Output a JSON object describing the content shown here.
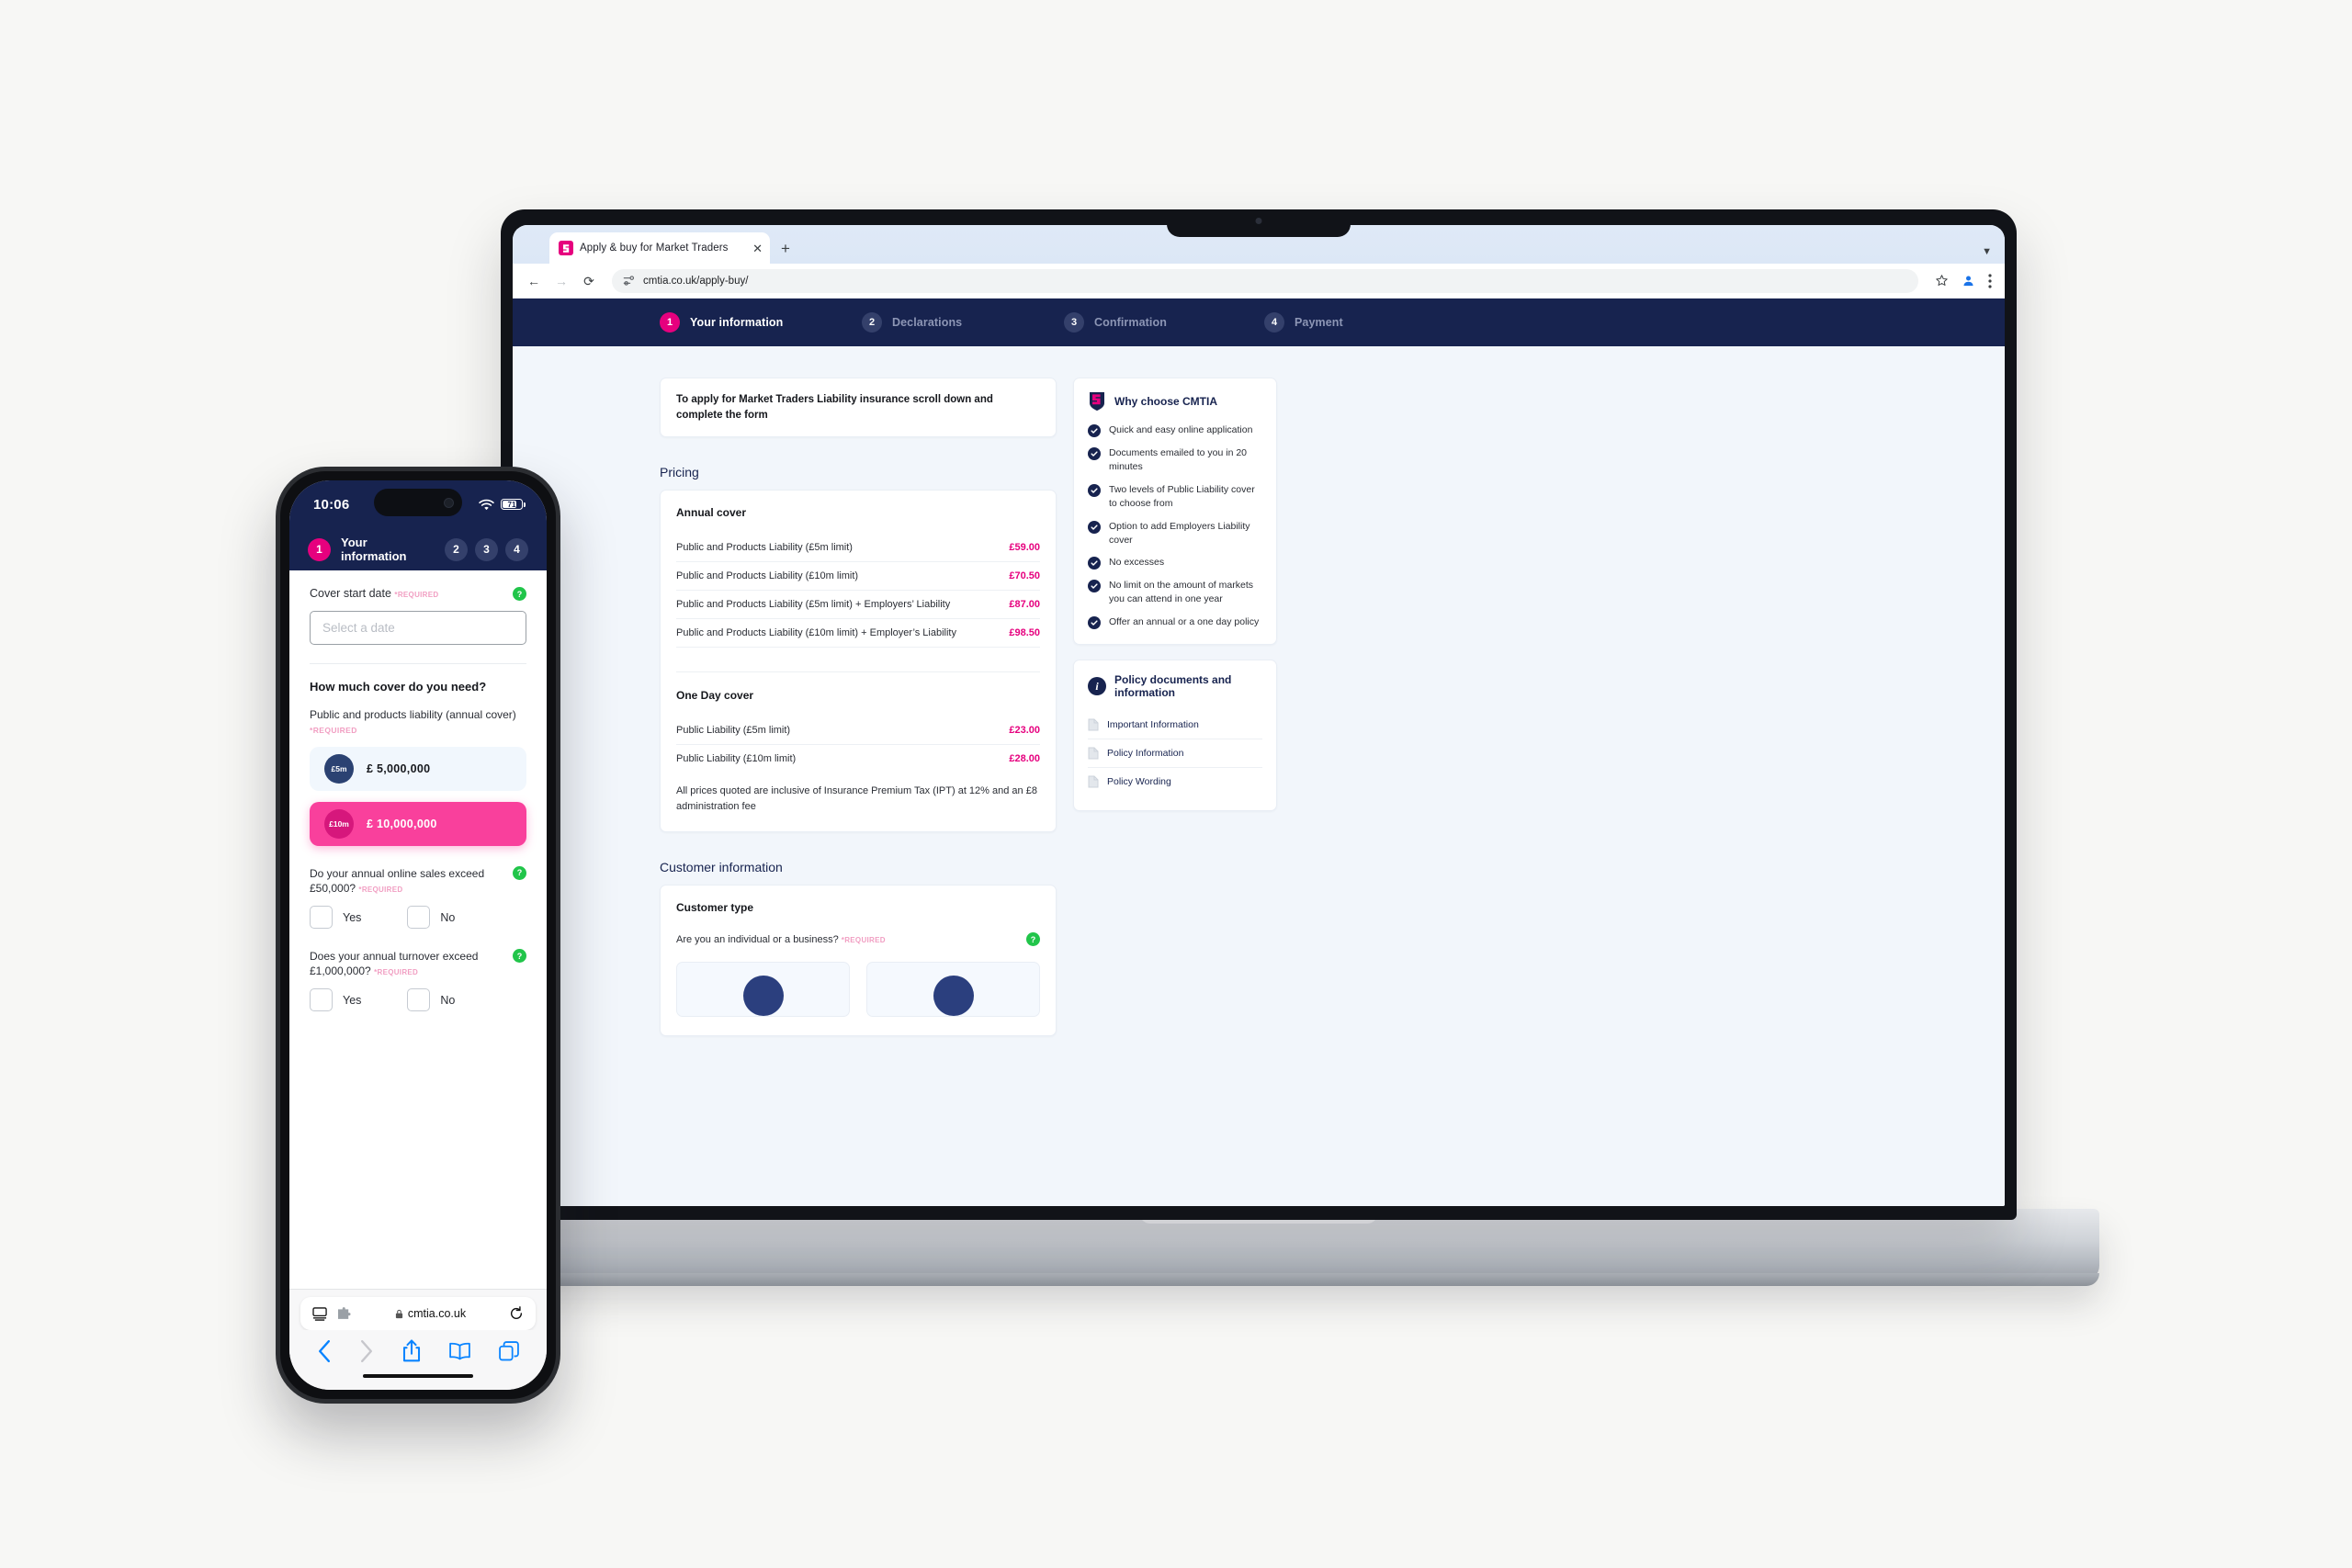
{
  "browser": {
    "tab_title": "Apply & buy for Market Traders",
    "tab_favicon": "cmtia-logo-icon",
    "close_icon": "close-icon",
    "newtab_icon": "new-tab-icon",
    "tabstrip_chevron": "chevron-down-icon",
    "back_icon": "back-arrow-icon",
    "forward_icon": "forward-arrow-icon",
    "reload_icon": "reload-icon",
    "site_info_icon": "site-settings-icon",
    "url": "cmtia.co.uk/apply-buy/",
    "bookmark_icon": "star-icon",
    "profile_icon": "profile-avatar-icon",
    "menu_icon": "kebab-menu-icon"
  },
  "steps": [
    {
      "num": "1",
      "label": "Your information",
      "state": "active"
    },
    {
      "num": "2",
      "label": "Declarations",
      "state": "idle"
    },
    {
      "num": "3",
      "label": "Confirmation",
      "state": "idle"
    },
    {
      "num": "4",
      "label": "Payment",
      "state": "idle"
    }
  ],
  "notice": "To apply for Market Traders Liability insurance scroll down and complete the form",
  "pricing": {
    "section_title": "Pricing",
    "annual_heading": "Annual cover",
    "annual_rows": [
      {
        "label": "Public and Products Liability (£5m limit)",
        "value": "£59.00"
      },
      {
        "label": "Public and Products Liability (£10m limit)",
        "value": "£70.50"
      },
      {
        "label": "Public and Products Liability (£5m limit) + Employers’ Liability",
        "value": "£87.00"
      },
      {
        "label": "Public and Products Liability (£10m limit) + Employer’s Liability",
        "value": "£98.50"
      }
    ],
    "oneday_heading": "One Day cover",
    "oneday_rows": [
      {
        "label": "Public Liability (£5m limit)",
        "value": "£23.00"
      },
      {
        "label": "Public Liability (£10m limit)",
        "value": "£28.00"
      }
    ],
    "note": "All prices quoted are inclusive of Insurance Premium Tax (IPT) at 12% and an £8 administration fee"
  },
  "why_choose": {
    "title": "Why choose CMTIA",
    "logo_icon": "cmtia-shield-logo-icon",
    "items": [
      "Quick and easy online application",
      "Documents emailed to you in 20 minutes",
      "Two levels of Public Liability cover to choose from",
      "Option to add Employers Liability cover",
      "No excesses",
      "No limit on the amount of markets you can attend in one year",
      "Offer an annual or a one day policy"
    ]
  },
  "policy_docs": {
    "title": "Policy documents and information",
    "info_icon": "info-circle-icon",
    "items": [
      "Important Information",
      "Policy Information",
      "Policy Wording"
    ]
  },
  "customer": {
    "section_title": "Customer information",
    "card_heading": "Customer type",
    "question": "Are you an individual or a business?",
    "required": "*REQUIRED",
    "help_icon": "help-question-icon"
  },
  "chat": {
    "icon": "chat-bubble-icon",
    "color": "#e01b5c"
  },
  "phone": {
    "status": {
      "time": "10:06",
      "wifi_icon": "wifi-icon",
      "battery_icon": "battery-icon",
      "battery_level": "71"
    },
    "steps": [
      {
        "num": "1",
        "label": "Your information",
        "state": "active"
      },
      {
        "num": "2",
        "state": "idle"
      },
      {
        "num": "3",
        "state": "idle"
      },
      {
        "num": "4",
        "state": "idle"
      }
    ],
    "cover_start": {
      "label": "Cover start date",
      "required": "*REQUIRED",
      "placeholder": "Select a date",
      "help_icon": "help-question-icon"
    },
    "cover_heading": "How much cover do you need?",
    "cover_sub": "Public and products liability (annual cover)",
    "cover_sub_required": "*REQUIRED",
    "cover_options": [
      {
        "badge": "£5m",
        "amount": "£ 5,000,000",
        "selected": false
      },
      {
        "badge": "£10m",
        "amount": "£ 10,000,000",
        "selected": true
      }
    ],
    "questions": [
      {
        "text": "Do your annual online sales exceed £50,000?",
        "required": "*REQUIRED",
        "yes": "Yes",
        "no": "No"
      },
      {
        "text": "Does your annual turnover exceed £1,000,000?",
        "required": "*REQUIRED",
        "yes": "Yes",
        "no": "No"
      }
    ],
    "browser": {
      "reader_icon": "reader-view-icon",
      "extension_icon": "extension-puzzle-icon",
      "lock_icon": "lock-icon",
      "url": "cmtia.co.uk",
      "reload_icon": "reload-icon",
      "back_icon": "back-chevron-icon",
      "forward_icon": "forward-chevron-icon",
      "share_icon": "share-icon",
      "bookmarks_icon": "book-icon",
      "tabs_icon": "tabs-icon"
    }
  },
  "colors": {
    "brand_navy": "#17234f",
    "brand_pink": "#e6007e",
    "accent_green": "#21c54a",
    "page_bg": "#f2f6fb"
  }
}
